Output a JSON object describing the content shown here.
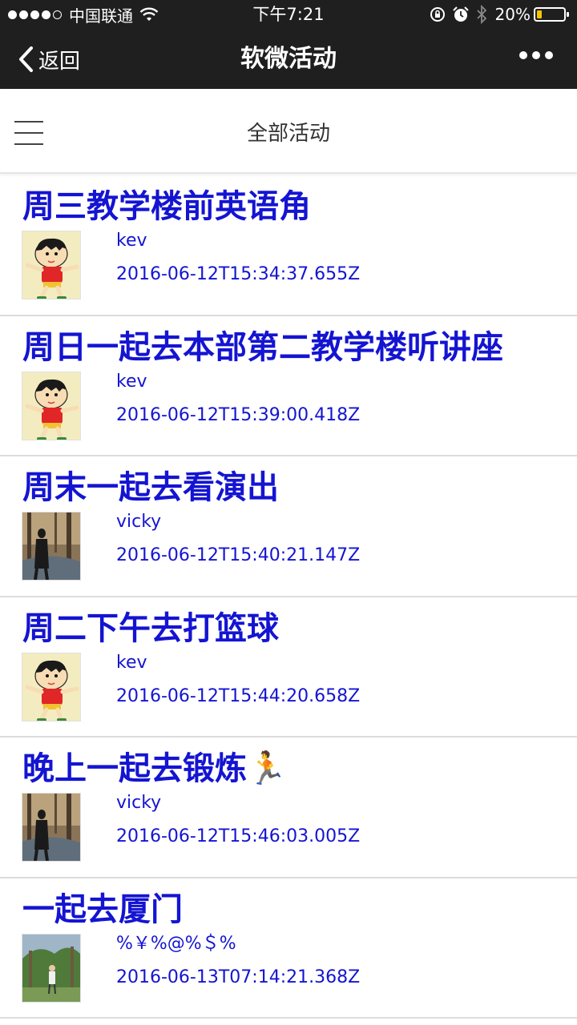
{
  "status_bar": {
    "carrier": "中国联通",
    "time": "下午7:21",
    "battery": "20%",
    "battery_level": 0.2,
    "signal_bars": 4,
    "icons": [
      "wifi-icon",
      "lock-rotation-icon",
      "alarm-icon",
      "bluetooth-icon",
      "battery-icon"
    ]
  },
  "navbar": {
    "back_label": "返回",
    "title": "软微活动",
    "more_icon": "more-dots-icon"
  },
  "subbar": {
    "title": "全部活动",
    "menu_icon": "hamburger-icon"
  },
  "activities": [
    {
      "title": "周三教学楼前英语角",
      "user": "kev",
      "time": "2016-06-12T15:34:37.655Z",
      "avatar": "cartoon-boy-avatar"
    },
    {
      "title": "周日一起去本部第二教学楼听讲座",
      "user": "kev",
      "time": "2016-06-12T15:39:00.418Z",
      "avatar": "cartoon-boy-avatar"
    },
    {
      "title": "周末一起去看演出",
      "user": "vicky",
      "time": "2016-06-12T15:40:21.147Z",
      "avatar": "forest-photo-avatar"
    },
    {
      "title": "周二下午去打篮球",
      "user": "kev",
      "time": "2016-06-12T15:44:20.658Z",
      "avatar": "cartoon-boy-avatar"
    },
    {
      "title": "晚上一起去锻炼🏃",
      "user": "vicky",
      "time": "2016-06-12T15:46:03.005Z",
      "avatar": "forest-photo-avatar"
    },
    {
      "title": "一起去厦门",
      "user": "%￥%@%＄%",
      "time": "2016-06-13T07:14:21.368Z",
      "avatar": "park-photo-avatar"
    }
  ],
  "colors": {
    "topbar_bg": "#1f1f1f",
    "link_blue": "#1414d2",
    "divider": "#dcdcdc"
  }
}
